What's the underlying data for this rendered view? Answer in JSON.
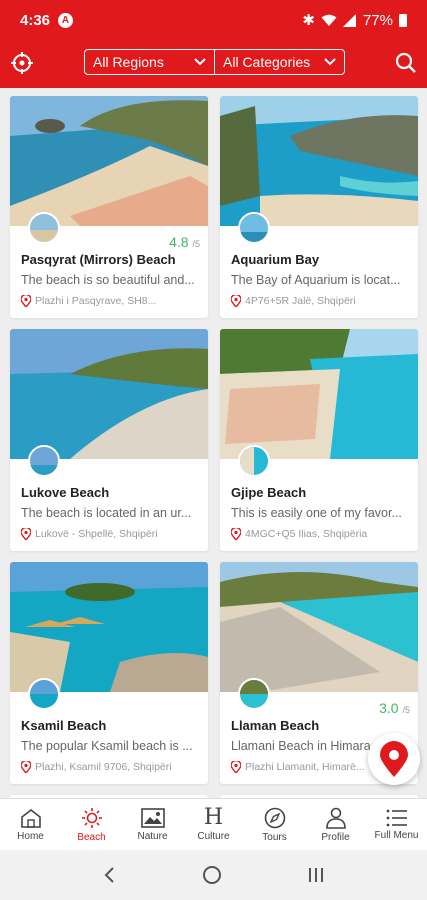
{
  "status": {
    "time": "4:36",
    "alert": "A",
    "battery": "77%"
  },
  "filters": {
    "region": "All Regions",
    "category": "All Categories"
  },
  "cards": [
    {
      "title": "Pasqyrat (Mirrors) Beach",
      "desc": "The beach is so beautiful and...",
      "addr": "Plazhi i Pasqyrave, SH8...",
      "rating": "4.8",
      "scale": "/5"
    },
    {
      "title": "Aquarium Bay",
      "desc": "The Bay of Aquarium is locat...",
      "addr": "4P76+5R Jalë, Shqipëri",
      "rating": "",
      "scale": ""
    },
    {
      "title": "Lukove Beach",
      "desc": "The beach is located in an ur...",
      "addr": "Lukovë - Shpellë, Shqipëri",
      "rating": "",
      "scale": ""
    },
    {
      "title": "Gjipe Beach",
      "desc": "This is easily one of my favor...",
      "addr": "4MGC+Q5 Ilias, Shqipëria",
      "rating": "",
      "scale": ""
    },
    {
      "title": "Ksamil Beach",
      "desc": "The popular Ksamil beach is ...",
      "addr": "Plazhi, Ksamil 9706, Shqipëri",
      "rating": "",
      "scale": ""
    },
    {
      "title": "Llaman Beach",
      "desc": "Llamani Beach in Himara...",
      "addr": "Plazhi Llamanit, Himarë...",
      "rating": "3.0",
      "scale": "/5"
    }
  ],
  "nav": [
    "Home",
    "Beach",
    "Nature",
    "Culture",
    "Tours",
    "Profile",
    "Full Menu"
  ],
  "colors": {
    "brand": "#e0191d",
    "rating": "#45b760"
  }
}
